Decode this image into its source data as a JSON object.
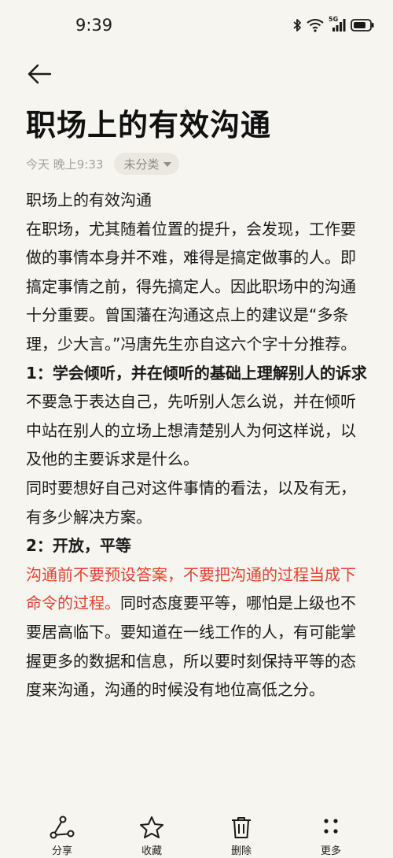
{
  "status_bar": {
    "time": "9:39",
    "signal_label": "5G",
    "icons": [
      "bluetooth-icon",
      "wifi-icon",
      "cellular-signal-icon",
      "battery-icon"
    ]
  },
  "note": {
    "title": "职场上的有效沟通",
    "meta_time": "今天 晚上9:33",
    "category": "未分类",
    "paragraphs": [
      {
        "kind": "normal",
        "text": "职场上的有效沟通"
      },
      {
        "kind": "normal",
        "text": "在职场，尤其随着位置的提升，会发现，工作要做的事情本身并不难，难得是搞定做事的人。即搞定事情之前，得先搞定人。因此职场中的沟通十分重要。曾国藩在沟通这点上的建议是“多条理，少大言。”冯唐先生亦自这六个字十分推荐。"
      },
      {
        "kind": "heading",
        "text": "1：学会倾听，并在倾听的基础上理解别人的诉求"
      },
      {
        "kind": "normal",
        "text": "不要急于表达自己，先听别人怎么说，并在倾听中站在别人的立场上想清楚别人为何这样说，以及他的主要诉求是什么。"
      },
      {
        "kind": "normal",
        "text": "同时要想好自己对这件事情的看法，以及有无，有多少解决方案。"
      },
      {
        "kind": "heading",
        "text": "2：开放，平等"
      },
      {
        "kind": "mixed",
        "highlight": "沟通前不要预设答案，不要把沟通的过程当成下命令的过程。",
        "text": "同时态度要平等，哪怕是上级也不要居高临下。要知道在一线工作的人，有可能掌握更多的数据和信息，所以要时刻保持平等的态度来沟通，沟通的时候没有地位高低之分。"
      }
    ]
  },
  "toolbar": {
    "share_label": "分享",
    "favorite_label": "收藏",
    "delete_label": "删除",
    "more_label": "更多"
  },
  "colors": {
    "background": "#f7f5f0",
    "text": "#1a1a1a",
    "highlight_red": "#e8402f",
    "meta_gray": "#a5a29c",
    "chip_bg": "#ebe8e2"
  }
}
